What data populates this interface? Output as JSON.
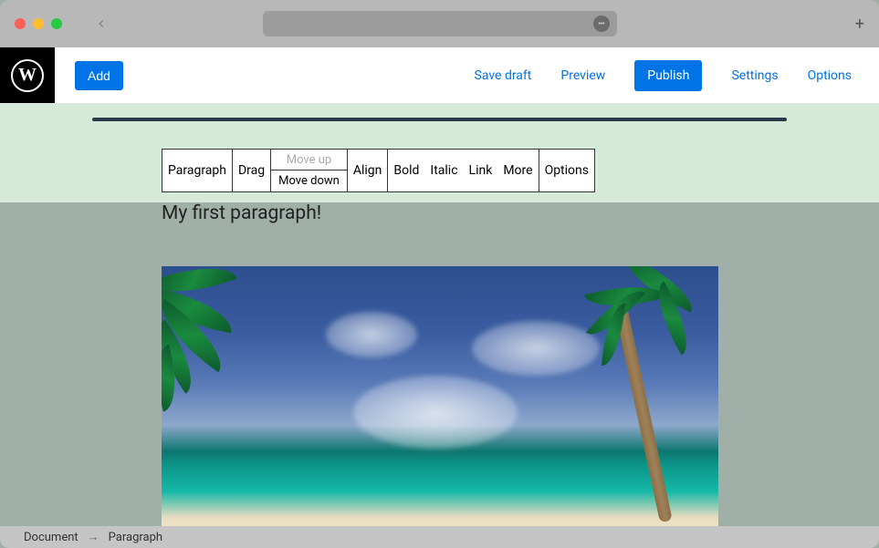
{
  "header": {
    "add_label": "Add",
    "save_draft": "Save draft",
    "preview": "Preview",
    "publish": "Publish",
    "settings": "Settings",
    "options": "Options"
  },
  "toolbar": {
    "block_type": "Paragraph",
    "drag": "Drag",
    "move_up": "Move up",
    "move_down": "Move down",
    "align": "Align",
    "bold": "Bold",
    "italic": "Italic",
    "link": "Link",
    "more": "More",
    "options": "Options"
  },
  "content": {
    "paragraph": "My first paragraph!"
  },
  "breadcrumb": {
    "root": "Document",
    "current": "Paragraph"
  }
}
